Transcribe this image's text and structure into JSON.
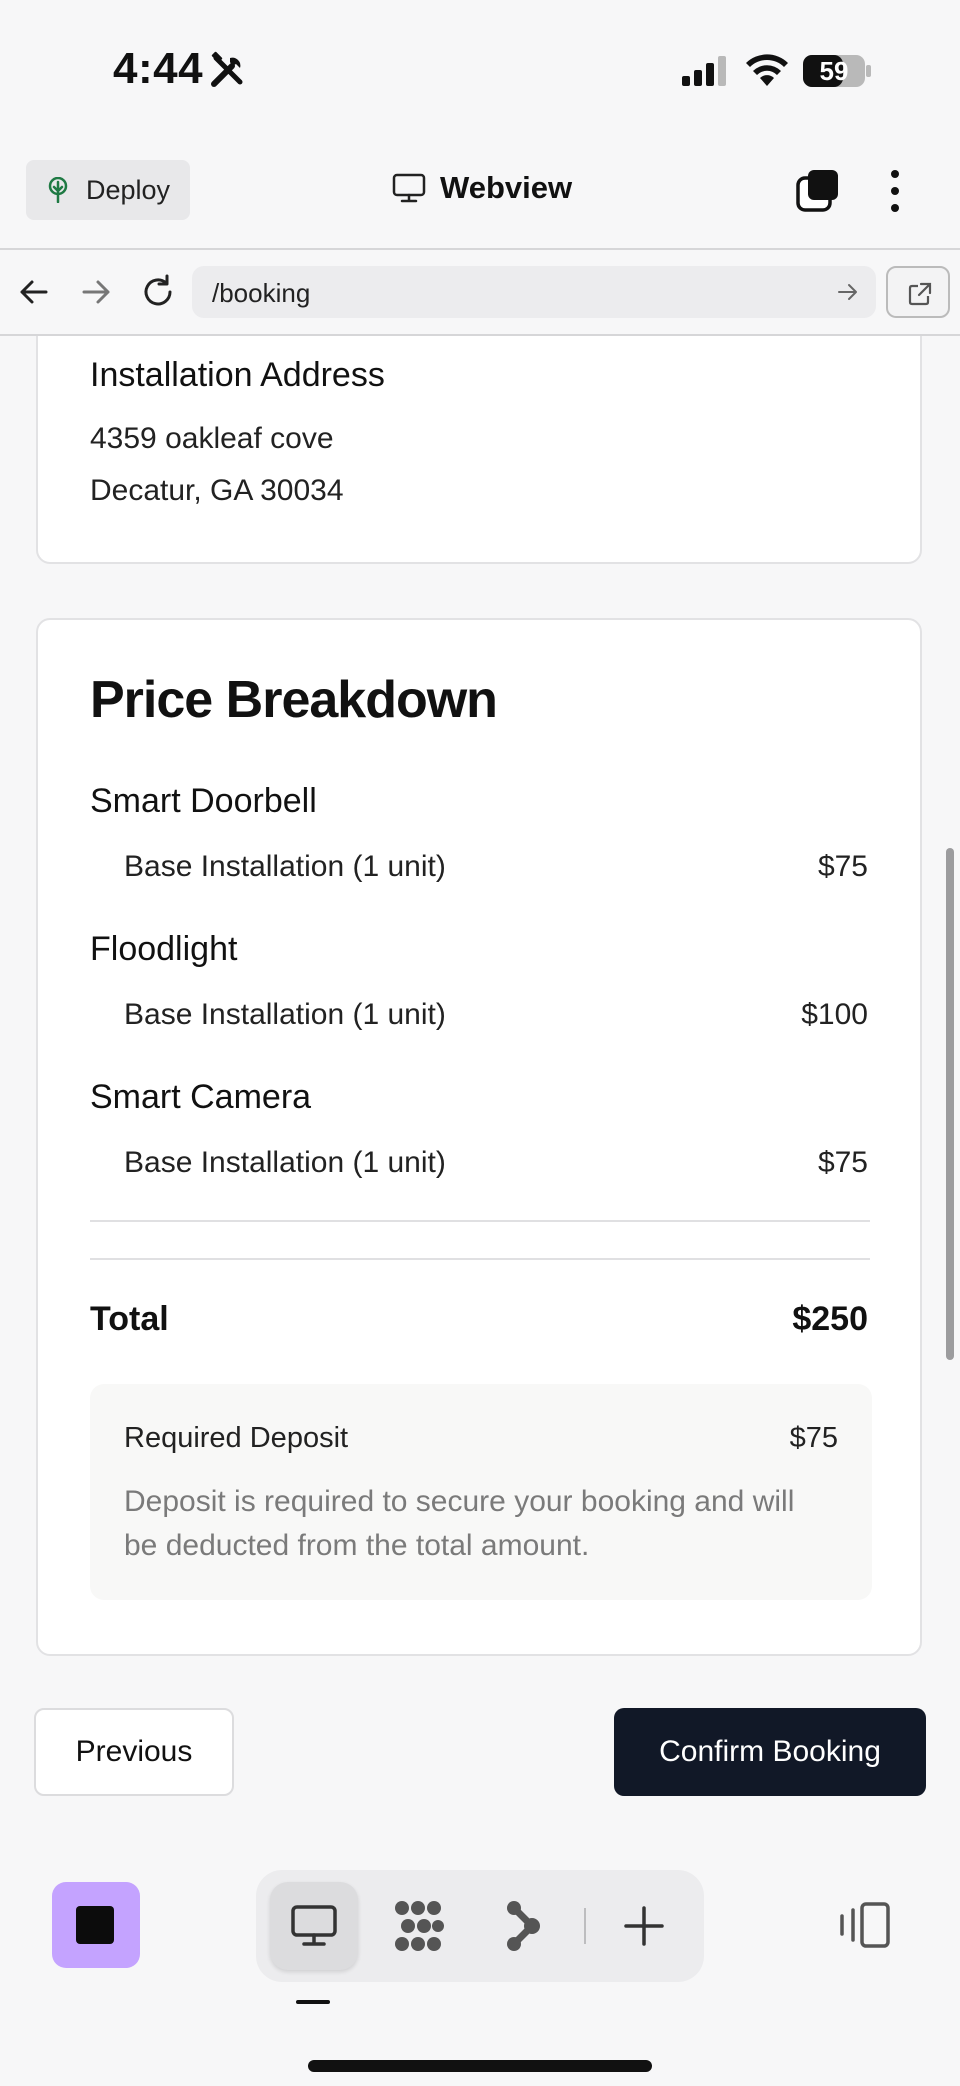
{
  "status_bar": {
    "time": "4:44",
    "battery": "59"
  },
  "app_header": {
    "deploy_label": "Deploy",
    "title": "Webview"
  },
  "url_bar": {
    "url": "/booking"
  },
  "address_card": {
    "title": "Installation Address",
    "line1": "4359 oakleaf cove",
    "line2": "Decatur, GA 30034"
  },
  "price_breakdown": {
    "title": "Price Breakdown",
    "items": [
      {
        "name": "Smart Doorbell",
        "line_label": "Base Installation (1 unit)",
        "price": "$75"
      },
      {
        "name": "Floodlight",
        "line_label": "Base Installation (1 unit)",
        "price": "$100"
      },
      {
        "name": "Smart Camera",
        "line_label": "Base Installation (1 unit)",
        "price": "$75"
      }
    ],
    "total_label": "Total",
    "total_value": "$250",
    "deposit": {
      "label": "Required Deposit",
      "value": "$75",
      "note": "Deposit is required to secure your booking and will be deducted from the total amount."
    }
  },
  "actions": {
    "previous_label": "Previous",
    "confirm_label": "Confirm Booking"
  },
  "icons": {
    "status": [
      "tools-icon",
      "signal-icon",
      "wifi-icon",
      "battery-icon"
    ],
    "header": [
      "deploy-tree-icon",
      "monitor-icon",
      "tabs-icon",
      "more-vertical-icon"
    ],
    "url_bar": [
      "back-arrow-icon",
      "forward-arrow-icon",
      "reload-icon",
      "go-arrow-icon",
      "external-link-icon"
    ],
    "bottom_bar": [
      "app-stop-icon",
      "desktop-icon",
      "grid-dots-icon",
      "branch-icon",
      "plus-icon",
      "split-view-icon"
    ]
  },
  "colors": {
    "accent_tile": "#c4a3ff",
    "primary_button": "#111827"
  }
}
